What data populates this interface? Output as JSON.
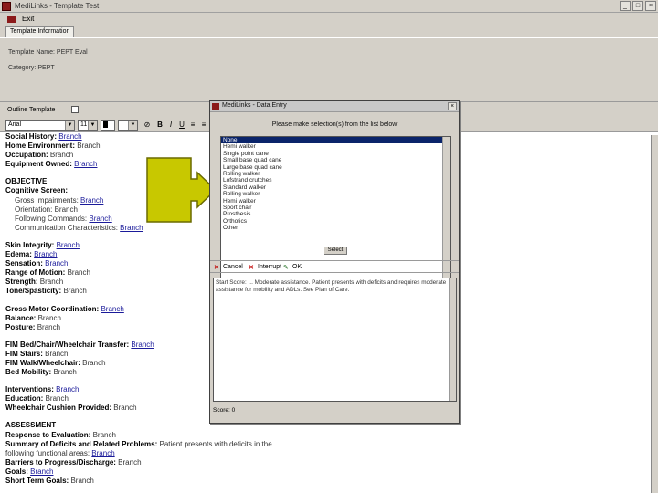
{
  "window": {
    "title": "MediLinks - Template Test",
    "controls": [
      "_",
      "□",
      "×"
    ]
  },
  "menu": {
    "item": "Exit"
  },
  "tab": {
    "label": "Template Information"
  },
  "template": {
    "name_label": "Template Name:",
    "name_value": "PEPT Eval",
    "category_label": "Category:",
    "category_value": "PEPT"
  },
  "options": {
    "outline_label": "Outline Template"
  },
  "toolbar": {
    "font": "Arial",
    "size": "11",
    "bold": "B",
    "italic": "I",
    "underline": "U"
  },
  "document": {
    "history": [
      {
        "label": "Social History:",
        "value": "Branch"
      },
      {
        "label": "Home Environment:",
        "value": "Branch"
      },
      {
        "label": "Occupation:",
        "value": "Branch"
      },
      {
        "label": "Equipment Owned:",
        "value": "Branch"
      }
    ],
    "objective_heading": "OBJECTIVE",
    "cognitive_heading": "Cognitive Screen:",
    "cognitive": [
      {
        "label": "Gross Impairments:",
        "value": "Branch"
      },
      {
        "label": "Orientation:",
        "value": "Branch"
      },
      {
        "label": "Following Commands:",
        "value": "Branch"
      },
      {
        "label": "Communication Characteristics:",
        "value": "Branch"
      }
    ],
    "physical": [
      {
        "label": "Skin Integrity:",
        "value": "Branch"
      },
      {
        "label": "Edema:",
        "value": "Branch"
      },
      {
        "label": "Sensation:",
        "value": "Branch"
      },
      {
        "label": "Range of Motion:",
        "value": "Branch"
      },
      {
        "label": "Strength:",
        "value": "Branch"
      },
      {
        "label": "Tone/Spasticity:",
        "value": "Branch"
      }
    ],
    "motor": [
      {
        "label": "Gross Motor Coordination:",
        "value": "Branch"
      },
      {
        "label": "Balance:",
        "value": "Branch"
      },
      {
        "label": "Posture:",
        "value": "Branch"
      }
    ],
    "fim": [
      {
        "label": "FIM Bed/Chair/Wheelchair Transfer:",
        "value": "Branch"
      },
      {
        "label": "FIM Stairs:",
        "value": "Branch"
      },
      {
        "label": "FIM Walk/Wheelchair:",
        "value": "Branch"
      },
      {
        "label": "Bed Mobility:",
        "value": "Branch"
      }
    ],
    "interventions": [
      {
        "label": "Interventions:",
        "value": "Branch"
      },
      {
        "label": "Education:",
        "value": "Branch"
      },
      {
        "label": "Wheelchair Cushion Provided:",
        "value": "Branch"
      }
    ],
    "assessment_heading": "ASSESSMENT",
    "response_label": "Response to Evaluation:",
    "response_value": "Branch",
    "summary_label": "Summary of Deficits and Related Problems:",
    "summary_text": "Patient presents with deficits in the",
    "summary_text2": "following functional areas:",
    "summary_value": "Branch",
    "barriers_label": "Barriers to Progress/Discharge:",
    "barriers_value": "Branch",
    "goals_label": "Goals:",
    "goals_value": "Branch",
    "stg_label": "Short Term Goals:",
    "stg_value": "Branch"
  },
  "dialog": {
    "title": "MediLinks - Data Entry",
    "prompt": "Please make selection(s) from the list below",
    "items": [
      "None",
      "Hemi walker",
      "Single point cane",
      "Small base quad cane",
      "Large base quad cane",
      "Rolling walker",
      "Lofstrand crutches",
      "Standard walker",
      "Rolling walker",
      "Hemi walker",
      "Sport chair",
      "Prosthesis",
      "Orthotics",
      "Other"
    ],
    "select_label": "Select",
    "cancel_label": "Cancel",
    "interrupt_label": "Interrupt",
    "ok_label": "OK",
    "preview_text": "Start Score: ... Moderate assistance. Patient presents with deficits and requires moderate assistance for mobility and ADLs. See Plan of Care.",
    "status_label": "Score: 0"
  },
  "colors": {
    "chrome": "#d4d0c8",
    "selection": "#0a246a",
    "link": "#1a1a9a",
    "arrow": "#c8c800"
  }
}
